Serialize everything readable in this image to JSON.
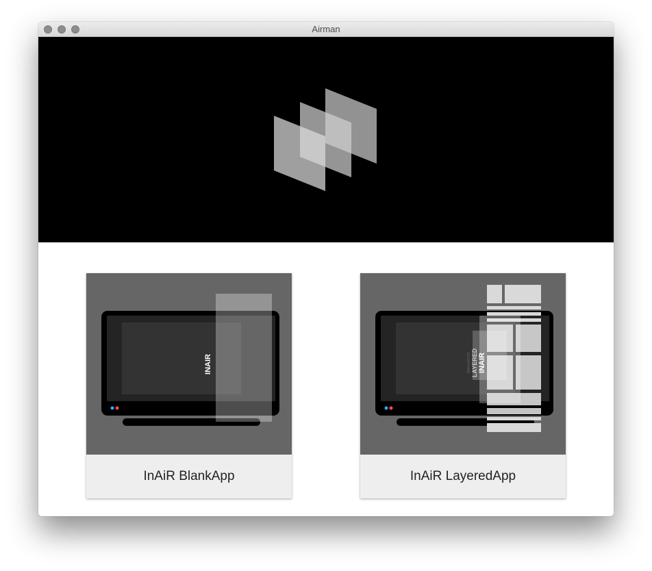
{
  "window": {
    "title": "Airman"
  },
  "colors": {
    "hero_background": "#000000",
    "card_image_background": "#666666",
    "card_label_background": "#eeeeee",
    "led_blue": "#3aa6ff",
    "led_red": "#ff4b4b"
  },
  "hero": {
    "logo_icon": "layered-planes-logo-icon"
  },
  "cards": [
    {
      "label": "InAiR BlankApp",
      "screen_text": "INAIR"
    },
    {
      "label": "InAiR LayeredApp",
      "screen_text": "INAIR",
      "screen_subtext": "LAYERED",
      "screen_microtext": "NAVIGATION"
    }
  ]
}
